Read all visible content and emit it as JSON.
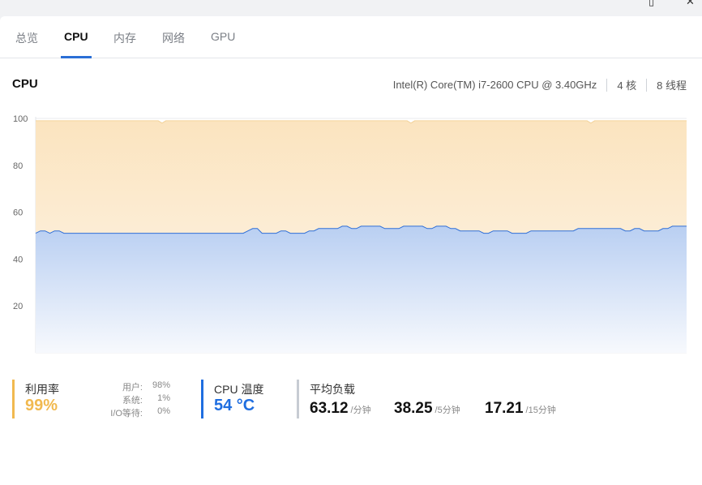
{
  "window": {
    "icons": [
      "window-icon",
      "close-icon"
    ]
  },
  "tabs": [
    {
      "label": "总览",
      "active": false
    },
    {
      "label": "CPU",
      "active": true
    },
    {
      "label": "内存",
      "active": false
    },
    {
      "label": "网络",
      "active": false
    },
    {
      "label": "GPU",
      "active": false
    }
  ],
  "header": {
    "title": "CPU",
    "model": "Intel(R) Core(TM) i7-2600 CPU @ 3.40GHz",
    "cores": "4 核",
    "threads": "8 线程"
  },
  "chart_data": {
    "type": "area",
    "ylim": [
      0,
      100
    ],
    "yticks": [
      100,
      80,
      60,
      40,
      20
    ],
    "grid": true,
    "series": [
      {
        "color": "#f5c27a",
        "values": [
          99,
          99,
          99,
          99,
          99,
          99,
          99,
          99,
          99,
          99,
          99,
          99,
          99,
          99,
          99,
          99,
          99,
          99,
          99,
          99,
          99,
          99,
          99,
          99,
          99,
          99,
          99,
          99,
          99,
          99,
          99,
          99,
          99,
          98,
          99,
          99,
          99,
          99,
          99,
          99,
          99,
          99,
          99,
          99,
          99,
          99,
          99,
          99,
          99,
          99,
          99,
          99,
          99,
          99,
          99,
          99,
          99,
          99,
          99,
          99,
          99,
          99,
          99,
          99,
          99,
          99,
          99,
          99,
          99,
          99,
          99,
          99,
          99,
          99,
          99,
          99,
          99,
          99,
          99,
          99,
          99,
          99,
          99,
          99,
          99,
          99,
          99,
          99,
          99,
          99,
          99,
          99,
          99,
          99,
          99,
          99,
          99,
          99,
          98,
          99,
          99,
          99,
          99,
          99,
          99,
          99,
          99,
          99,
          99,
          99,
          99,
          99,
          99,
          99,
          99,
          99,
          99,
          99,
          99,
          99,
          99,
          99,
          99,
          99,
          99,
          99,
          99,
          99,
          99,
          99,
          99,
          99,
          99,
          99,
          99,
          99,
          99,
          99,
          99,
          99,
          99,
          99,
          99,
          99,
          99,
          98,
          99,
          99,
          99,
          99,
          99,
          99,
          99,
          99,
          99,
          99,
          99,
          99,
          99,
          99,
          99,
          99,
          99,
          99,
          99,
          99,
          99,
          99,
          99,
          99,
          99
        ]
      },
      {
        "color": "#2f6fd8",
        "values": [
          51,
          52,
          52,
          51,
          52,
          52,
          51,
          51,
          51,
          51,
          51,
          51,
          51,
          51,
          51,
          51,
          51,
          51,
          51,
          51,
          51,
          51,
          51,
          51,
          51,
          51,
          51,
          51,
          51,
          51,
          51,
          51,
          51,
          51,
          51,
          51,
          51,
          51,
          51,
          51,
          51,
          51,
          51,
          51,
          51,
          52,
          53,
          53,
          51,
          51,
          51,
          51,
          52,
          52,
          51,
          51,
          51,
          51,
          52,
          52,
          53,
          53,
          53,
          53,
          53,
          54,
          54,
          53,
          53,
          54,
          54,
          54,
          54,
          54,
          53,
          53,
          53,
          53,
          54,
          54,
          54,
          54,
          54,
          53,
          53,
          54,
          54,
          54,
          53,
          53,
          52,
          52,
          52,
          52,
          52,
          51,
          51,
          52,
          52,
          52,
          52,
          51,
          51,
          51,
          51,
          52,
          52,
          52,
          52,
          52,
          52,
          52,
          52,
          52,
          52,
          53,
          53,
          53,
          53,
          53,
          53,
          53,
          53,
          53,
          53,
          52,
          52,
          53,
          53,
          52,
          52,
          52,
          52,
          53,
          53,
          54,
          54,
          54,
          54
        ]
      }
    ]
  },
  "stats": {
    "utilization": {
      "label": "利用率",
      "value": "99%",
      "color": "#f1b94f",
      "rows": [
        {
          "k": "用户:",
          "v": "98%"
        },
        {
          "k": "系统:",
          "v": "1%"
        },
        {
          "k": "I/O等待:",
          "v": "0%"
        }
      ]
    },
    "temperature": {
      "label": "CPU 温度",
      "value": "54 °C",
      "color": "#1f6ee0"
    },
    "load": {
      "label": "平均负载",
      "color": "#c7ccd3",
      "items": [
        {
          "value": "63.12",
          "unit": "/分钟"
        },
        {
          "value": "38.25",
          "unit": "/5分钟"
        },
        {
          "value": "17.21",
          "unit": "/15分钟"
        }
      ]
    }
  }
}
